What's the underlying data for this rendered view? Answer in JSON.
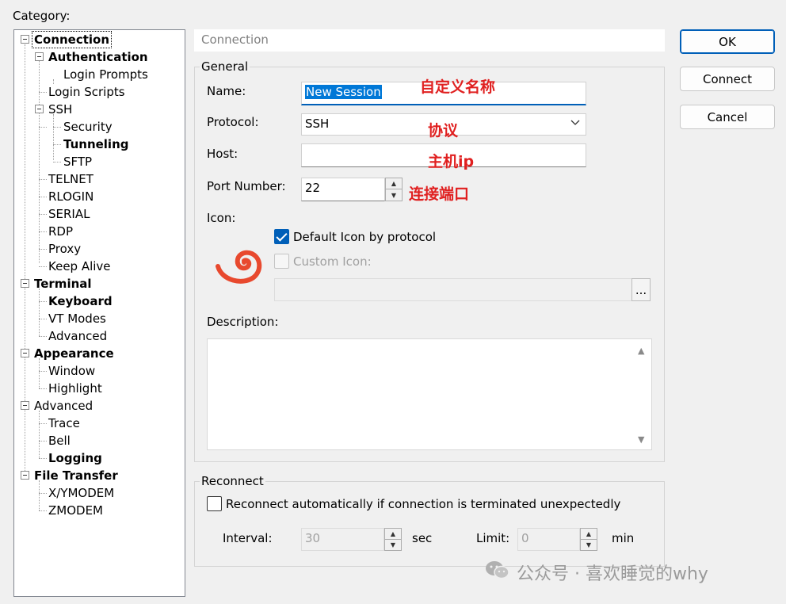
{
  "category_label": "Category:",
  "tree": {
    "connection": "Connection",
    "authentication": "Authentication",
    "login_prompts": "Login Prompts",
    "login_scripts": "Login Scripts",
    "ssh": "SSH",
    "security": "Security",
    "tunneling": "Tunneling",
    "sftp": "SFTP",
    "telnet": "TELNET",
    "rlogin": "RLOGIN",
    "serial": "SERIAL",
    "rdp": "RDP",
    "proxy": "Proxy",
    "keep_alive": "Keep Alive",
    "terminal": "Terminal",
    "keyboard": "Keyboard",
    "vt_modes": "VT Modes",
    "terminal_advanced": "Advanced",
    "appearance": "Appearance",
    "window": "Window",
    "highlight": "Highlight",
    "advanced": "Advanced",
    "trace": "Trace",
    "bell": "Bell",
    "logging": "Logging",
    "file_transfer": "File Transfer",
    "xymodem": "X/YMODEM",
    "zmodem": "ZMODEM"
  },
  "panel_title": "Connection",
  "general": {
    "title": "General",
    "name_label": "Name:",
    "name_value": "New Session",
    "protocol_label": "Protocol:",
    "protocol_value": "SSH",
    "host_label": "Host:",
    "host_value": "",
    "port_label": "Port Number:",
    "port_value": "22",
    "icon_label": "Icon:",
    "default_icon_label": "Default Icon by protocol",
    "custom_icon_label": "Custom Icon:",
    "browse_label": "...",
    "description_label": "Description:",
    "description_value": ""
  },
  "reconnect": {
    "title": "Reconnect",
    "auto_label": "Reconnect automatically if connection is terminated unexpectedly",
    "interval_label": "Interval:",
    "interval_value": "30",
    "sec_label": "sec",
    "limit_label": "Limit:",
    "limit_value": "0",
    "min_label": "min"
  },
  "buttons": {
    "ok": "OK",
    "connect": "Connect",
    "cancel": "Cancel"
  },
  "annotations": {
    "name": "自定义名称",
    "protocol": "协议",
    "host": "主机ip",
    "port": "连接端口"
  },
  "watermark": "公众号 · 喜欢睡觉的why",
  "colors": {
    "accent": "#005fb8",
    "selection": "#0078d7",
    "annotation": "#e02020",
    "app_icon": "#e8492e"
  }
}
